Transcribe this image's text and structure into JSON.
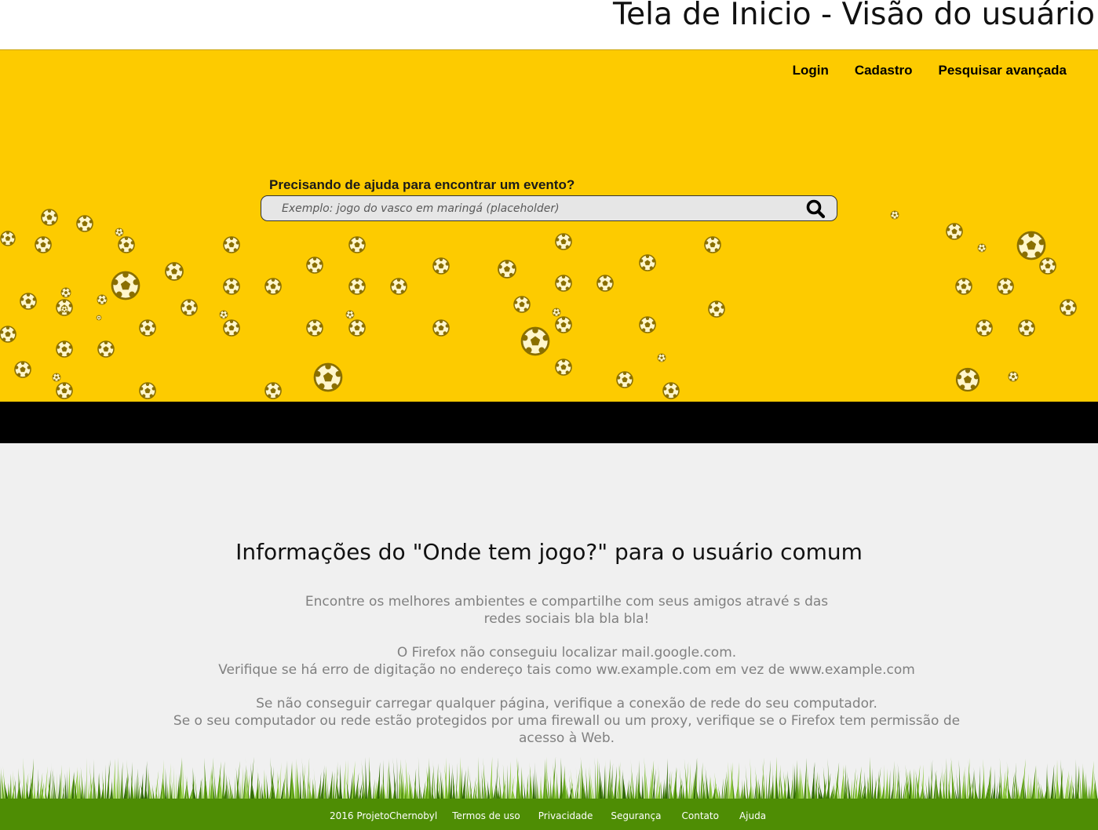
{
  "page": {
    "title": "Tela de Inicio - Visão do usuário"
  },
  "nav": {
    "items": [
      "Login",
      "Cadastro",
      "Pesquisar avançada"
    ]
  },
  "search": {
    "label": "Precisando de ajuda para encontrar um evento?",
    "placeholder": "Exemplo: jogo do vasco em maringá (placeholder)",
    "button_icon": "search-icon"
  },
  "info": {
    "heading": "Informações do \"Onde tem jogo?\" para o usuário comum",
    "lines": [
      "Encontre os melhores ambientes e compartilhe com seus amigos atravé s das",
      "redes sociais bla bla bla!",
      "",
      "O Firefox não conseguiu localizar mail.google.com.",
      "Verifique se há erro de digitação no endereço tais como  ww.example.com em vez de  www.example.com",
      "",
      "Se não conseguir carregar qualquer página, verifique a conexão de rede  do seu computador.",
      "Se o seu computador ou rede estão protegidos por uma firewall ou um proxy, verifique se o Firefox tem permissão de",
      "acesso à Web."
    ]
  },
  "footer": {
    "links": [
      "2016 ProjetoChernobyl",
      "Termos de uso",
      "Privacidade",
      "Segurança",
      "Contato",
      "Ajuda"
    ]
  },
  "colors": {
    "hero": "#fdcb00",
    "ball": "#8a6f00",
    "band": "#000000",
    "info_bg": "#f0f0f0",
    "footer": "#4e8d04"
  }
}
